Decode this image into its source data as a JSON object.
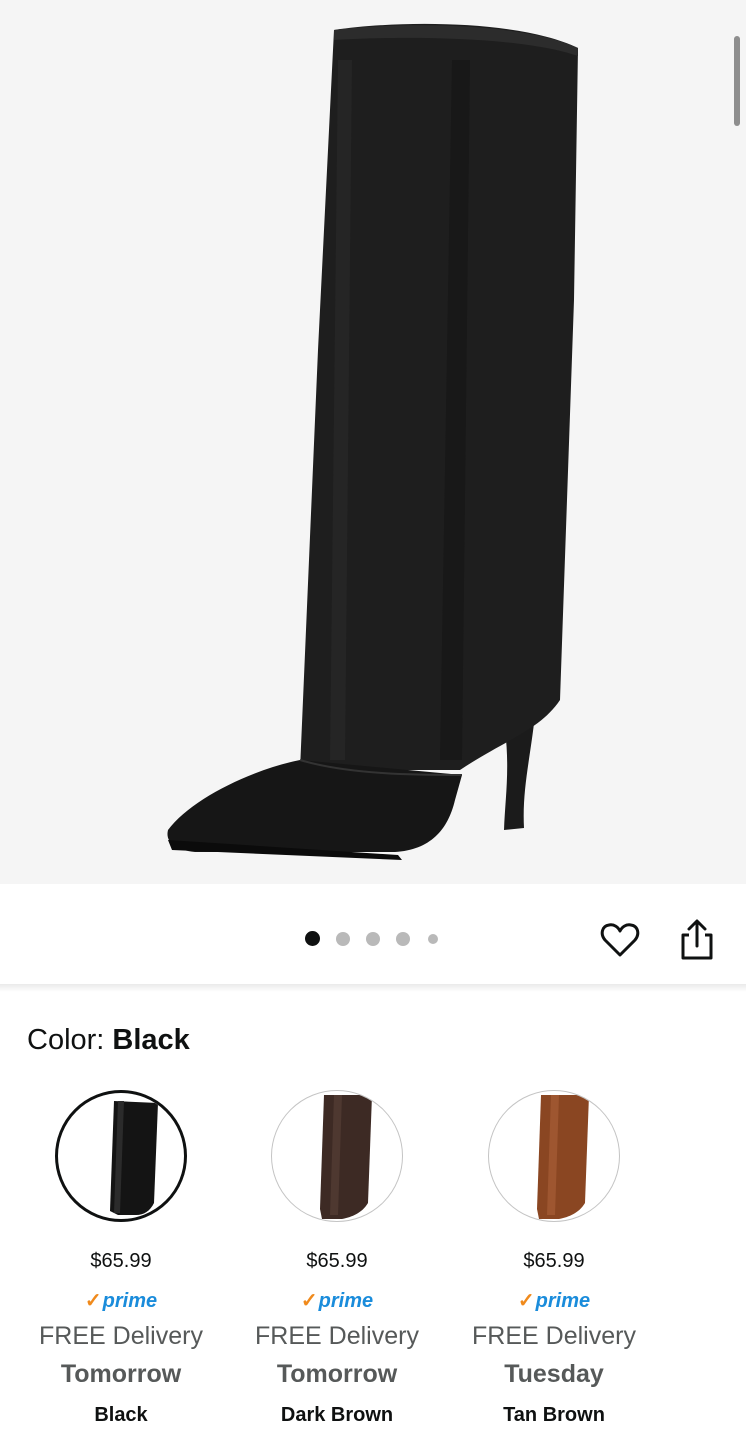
{
  "gallery": {
    "image_alt": "Black knee-high pointed-toe stiletto boot",
    "dots_total": 5,
    "active_dot": 0
  },
  "actions": {
    "wishlist_icon": "heart-icon",
    "share_icon": "share-icon"
  },
  "color_selector": {
    "label": "Color:",
    "selected": "Black",
    "options": [
      {
        "price": "$65.99",
        "prime": "prime",
        "delivery": "FREE Delivery",
        "when": "Tomorrow",
        "name": "Black",
        "swatch_color": "#141414"
      },
      {
        "price": "$65.99",
        "prime": "prime",
        "delivery": "FREE Delivery",
        "when": "Tomorrow",
        "name": "Dark Brown",
        "swatch_color": "#3d2a24"
      },
      {
        "price": "$65.99",
        "prime": "prime",
        "delivery": "FREE Delivery",
        "when": "Tuesday",
        "name": "Tan Brown",
        "swatch_color": "#8a4622"
      }
    ]
  },
  "colors": {
    "prime_blue": "#1a8cdb",
    "prime_check": "#f08a1c",
    "text_gray": "#565959"
  }
}
